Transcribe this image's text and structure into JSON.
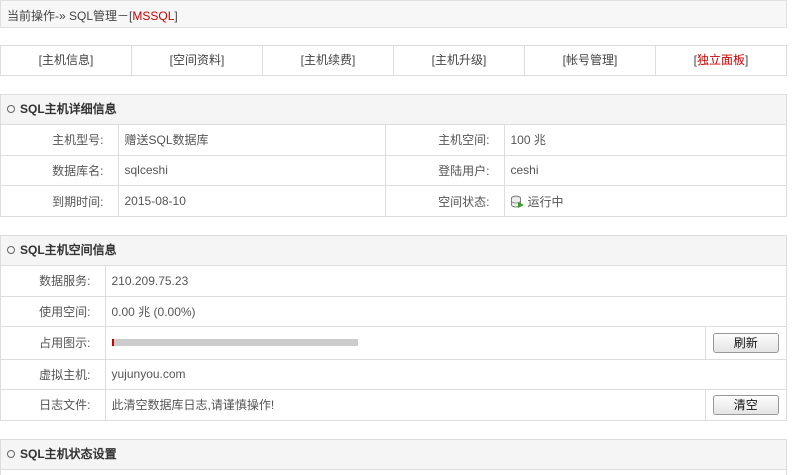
{
  "breadcrumb": {
    "prefix": "当前操作-» SQL管理－[",
    "highlight": "MSSQL",
    "suffix": "]"
  },
  "tabs": [
    {
      "label": "[主机信息]"
    },
    {
      "label": "[空间资料]"
    },
    {
      "label": "[主机续费]"
    },
    {
      "label": "[主机升级]"
    },
    {
      "label": "[帐号管理]"
    },
    {
      "open": "[",
      "label": "独立面板",
      "close": "]"
    }
  ],
  "detail": {
    "title": "SQL主机详细信息",
    "rows": [
      {
        "l1": "主机型号:",
        "v1": "赠送SQL数据库",
        "l2": "主机空间:",
        "v2": "100 兆"
      },
      {
        "l1": "数据库名:",
        "v1": "sqlceshi",
        "l2": "登陆用户:",
        "v2": "ceshi"
      },
      {
        "l1": "到期时间:",
        "v1": "2015-08-10",
        "l2": "空间状态:",
        "v2": "运行中"
      }
    ],
    "status_icon": "database-running-icon",
    "colors": {
      "run_icon_green": "#3a9a2a"
    }
  },
  "space": {
    "title": "SQL主机空间信息",
    "server_label": "数据服务:",
    "server_value": "210.209.75.23",
    "used_label": "使用空间:",
    "used_value": "0.00 兆  (0.00%)",
    "chart_label": "占用图示:",
    "usage_fraction": 0.0,
    "refresh_btn": "刷新",
    "vhost_label": "虚拟主机:",
    "vhost_value": "yujunyou.com",
    "log_label": "日志文件:",
    "log_value": "此清空数据库日志,请谨慎操作!",
    "clear_btn": "清空"
  },
  "status": {
    "title": "SQL主机状态设置"
  },
  "colors": {
    "accent_red": "#cc0000",
    "header_bg": "#f5f5f5",
    "border": "#dddddd"
  }
}
